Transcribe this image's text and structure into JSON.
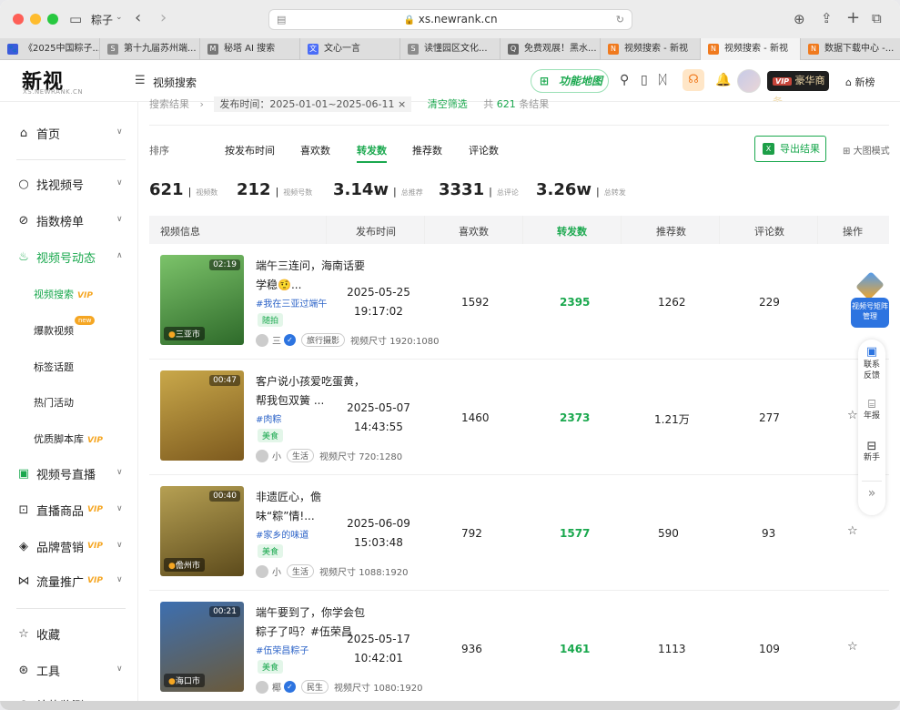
{
  "browser": {
    "window_title": "粽子",
    "url": "xs.newrank.cn",
    "tabs": [
      {
        "label": "《2025中国粽子...",
        "color": "#3b5bdb",
        "glyph": "🐾"
      },
      {
        "label": "第十九届苏州端...",
        "color": "#8c8c8c",
        "glyph": "S"
      },
      {
        "label": "秘塔 AI 搜索",
        "color": "#777",
        "glyph": "M"
      },
      {
        "label": "文心一言",
        "color": "#4a6cf7",
        "glyph": "文"
      },
      {
        "label": "读懂园区文化...",
        "color": "#8c8c8c",
        "glyph": "S"
      },
      {
        "label": "免费观展！黑水...",
        "color": "#666",
        "glyph": "Q"
      },
      {
        "label": "视频搜索 - 新视",
        "color": "#f07a1e",
        "glyph": "N"
      },
      {
        "label": "视频搜索 - 新视",
        "color": "#f07a1e",
        "glyph": "N"
      },
      {
        "label": "数据下载中心 -...",
        "color": "#f07a1e",
        "glyph": "N"
      }
    ]
  },
  "header": {
    "logo": "新视",
    "logo_sub": "XS.NEWRANK.CN",
    "section_title": "视频搜索",
    "map_button": "功能地图",
    "vip_label": "豪华商务",
    "vip_tag": "VIP",
    "home_link": "新榜"
  },
  "sidebar": {
    "home": "首页",
    "find_channel": "找视频号",
    "index_rank": "指数榜单",
    "dynamics": "视频号动态",
    "sub_items": {
      "video_search": "视频搜索",
      "hot_videos": "爆款视频",
      "tag_topics": "标签话题",
      "hot_events": "热门活动",
      "scripts": "优质脚本库"
    },
    "live": "视频号直播",
    "live_goods": "直播商品",
    "brand_marketing": "品牌营销",
    "traffic": "流量推广",
    "favorites": "收藏",
    "tools": "工具",
    "more": "补热监测",
    "vip_text": "VIP",
    "new_text": "new"
  },
  "filters": {
    "crumb_results": "搜索结果",
    "date_range": "发布时间：2025-01-01~2025-06-11",
    "clear": "清空筛选",
    "total_prefix": "共",
    "total_count": "621",
    "total_suffix": "条结果"
  },
  "sort": {
    "label": "排序",
    "options": [
      "按发布时间",
      "喜欢数",
      "转发数",
      "推荐数",
      "评论数"
    ],
    "active_index": 2,
    "export": "导出结果",
    "big_mode": "大图模式"
  },
  "stats": [
    {
      "value": "621",
      "label": "视频数"
    },
    {
      "value": "212",
      "label": "视频号数"
    },
    {
      "value": "3.14w",
      "label": "总推荐"
    },
    {
      "value": "3331",
      "label": "总评论"
    },
    {
      "value": "3.26w",
      "label": "总转发"
    }
  ],
  "table": {
    "headers": [
      "视频信息",
      "发布时间",
      "喜欢数",
      "转发数",
      "推荐数",
      "评论数",
      "操作"
    ],
    "rows": [
      {
        "title": "端午三连问，海南话要学稳🤨...",
        "tag": "#我在三亚过端午",
        "category": "随拍",
        "author": "三",
        "author_type": "旅行摄影",
        "size": "视频尺寸 1920:1080",
        "duration": "02:19",
        "location": "三亚市",
        "date": "2025-05-25",
        "time": "19:17:02",
        "likes": "1592",
        "shares": "2395",
        "recommends": "1262",
        "comments": "229",
        "thumb_colors": [
          "#7cc36a",
          "#2e6a2a"
        ]
      },
      {
        "title": "客户说小孩爱吃蛋黄，帮我包双簧 ...",
        "tag": "#肉粽",
        "category": "美食",
        "author": "小",
        "author_type": "生活",
        "size": "视频尺寸 720:1280",
        "duration": "00:47",
        "location": "",
        "date": "2025-05-07",
        "time": "14:43:55",
        "likes": "1460",
        "shares": "2373",
        "recommends": "1.21万",
        "comments": "277",
        "thumb_colors": [
          "#c9a84a",
          "#7d5a1e"
        ]
      },
      {
        "title": "非遗匠心，儋味“粽”情!...",
        "tag": "#家乡的味道",
        "category": "美食",
        "author": "小",
        "author_type": "生活",
        "size": "视频尺寸 1088:1920",
        "duration": "00:40",
        "location": "儋州市",
        "date": "2025-06-09",
        "time": "15:03:48",
        "likes": "792",
        "shares": "1577",
        "recommends": "590",
        "comments": "93",
        "thumb_colors": [
          "#b6a053",
          "#5d4b1c"
        ]
      },
      {
        "title": "端午要到了，你学会包粽子了吗？#伍荣昌",
        "tag": "#伍荣昌粽子",
        "category": "美食",
        "author": "椰",
        "author_type": "民生",
        "size": "视频尺寸 1080:1920",
        "duration": "00:21",
        "location": "海口市",
        "date": "2025-05-17",
        "time": "10:42:01",
        "likes": "936",
        "shares": "1461",
        "recommends": "1113",
        "comments": "109",
        "thumb_colors": [
          "#3d6fb0",
          "#6b5a3a"
        ]
      }
    ]
  },
  "right_panel": {
    "matrix": "视频号矩阵管理",
    "feedback": "联系反馈",
    "report": "年报",
    "guide": "新手"
  },
  "colors": {
    "accent": "#1aa84e",
    "link": "#2d64c8",
    "vip": "#f5a623"
  }
}
